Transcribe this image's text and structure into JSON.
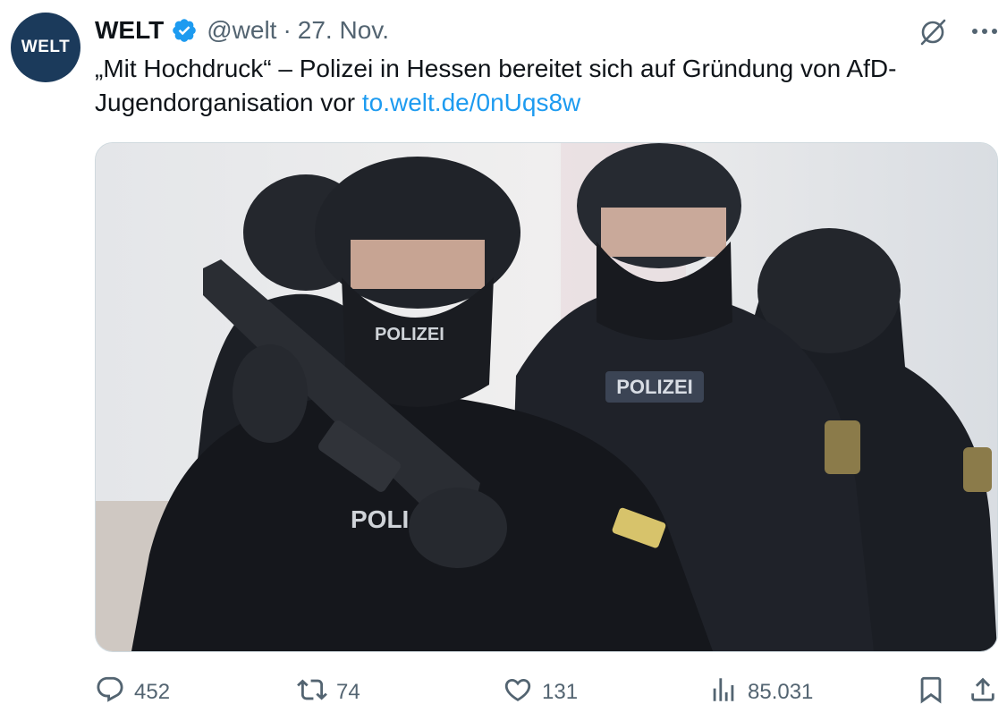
{
  "author": {
    "avatar_text": "WELT",
    "name": "WELT",
    "handle": "@welt",
    "separator": "·",
    "date": "27. Nov.",
    "avatar_color": "#1b3a5b",
    "verified_color": "#1d9bf0"
  },
  "tweet": {
    "text": "„Mit Hochdruck“ – Polizei in Hessen bereitet sich auf Gründung von AfD-Jugendorganisation vor ",
    "link": "to.welt.de/0nUqs8w"
  },
  "media": {
    "uniform_texts": [
      "POLIZEI",
      "POLIZEI",
      "POLI",
      "POLIZEI"
    ]
  },
  "actions": {
    "replies": "452",
    "reposts": "74",
    "likes": "131",
    "views": "85.031"
  },
  "icons": {
    "top_right": [
      "grok-icon",
      "more-icon"
    ],
    "actions": [
      "reply-icon",
      "repost-icon",
      "like-icon",
      "views-icon",
      "bookmark-icon",
      "share-icon"
    ]
  },
  "colors": {
    "link": "#1d9bf0",
    "muted": "#536471"
  }
}
